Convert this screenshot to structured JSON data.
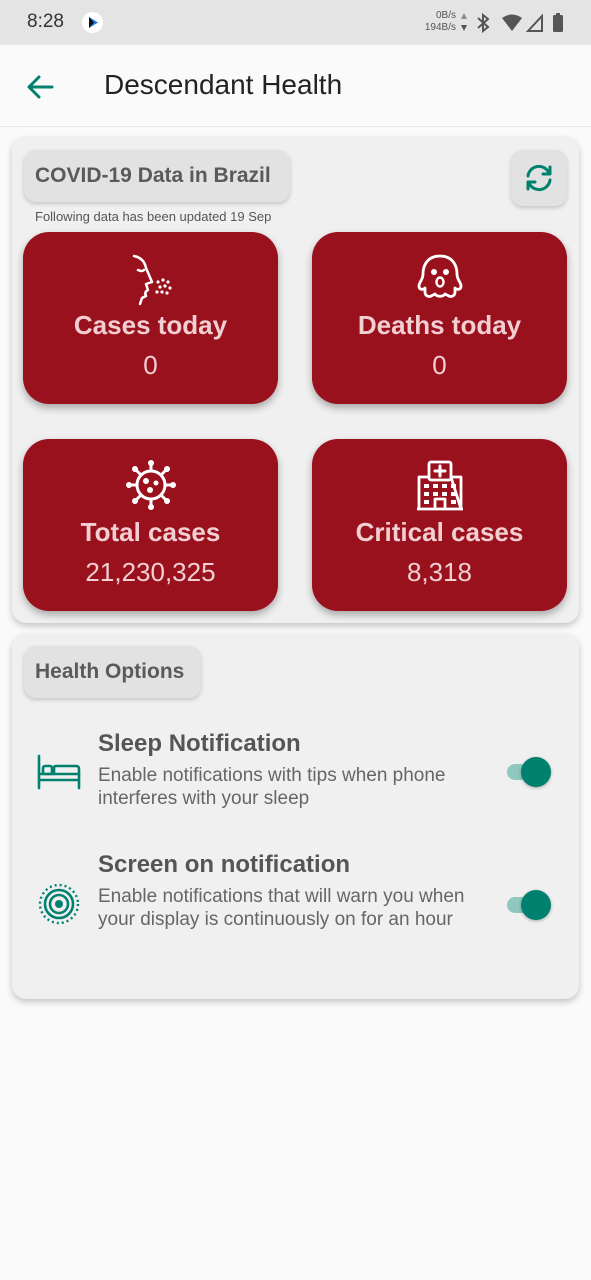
{
  "status_bar": {
    "time": "8:28",
    "net_down": "0B/s",
    "net_up": "194B/s"
  },
  "app_bar": {
    "title": "Descendant Health"
  },
  "covid": {
    "heading": "COVID-19 Data in Brazil",
    "updated_note": "Following data has been updated 19 Sep",
    "tiles": [
      {
        "label": "Cases today",
        "value": "0",
        "icon": "sneeze-icon"
      },
      {
        "label": "Deaths today",
        "value": "0",
        "icon": "ghost-icon"
      },
      {
        "label": "Total cases",
        "value": "21,230,325",
        "icon": "virus-icon"
      },
      {
        "label": "Critical cases",
        "value": "8,318",
        "icon": "hospital-icon"
      }
    ]
  },
  "health": {
    "heading": "Health Options",
    "options": [
      {
        "title": "Sleep Notification",
        "description": "Enable notifications with tips when phone interferes with your sleep",
        "enabled": true,
        "icon": "bed-icon"
      },
      {
        "title": "Screen on notification",
        "description": "Enable notifications that will warn you when your display is continuously on for an hour",
        "enabled": true,
        "icon": "screen-radiate-icon"
      }
    ]
  },
  "colors": {
    "tile_bg": "#9a111e",
    "accent": "#00806e"
  }
}
